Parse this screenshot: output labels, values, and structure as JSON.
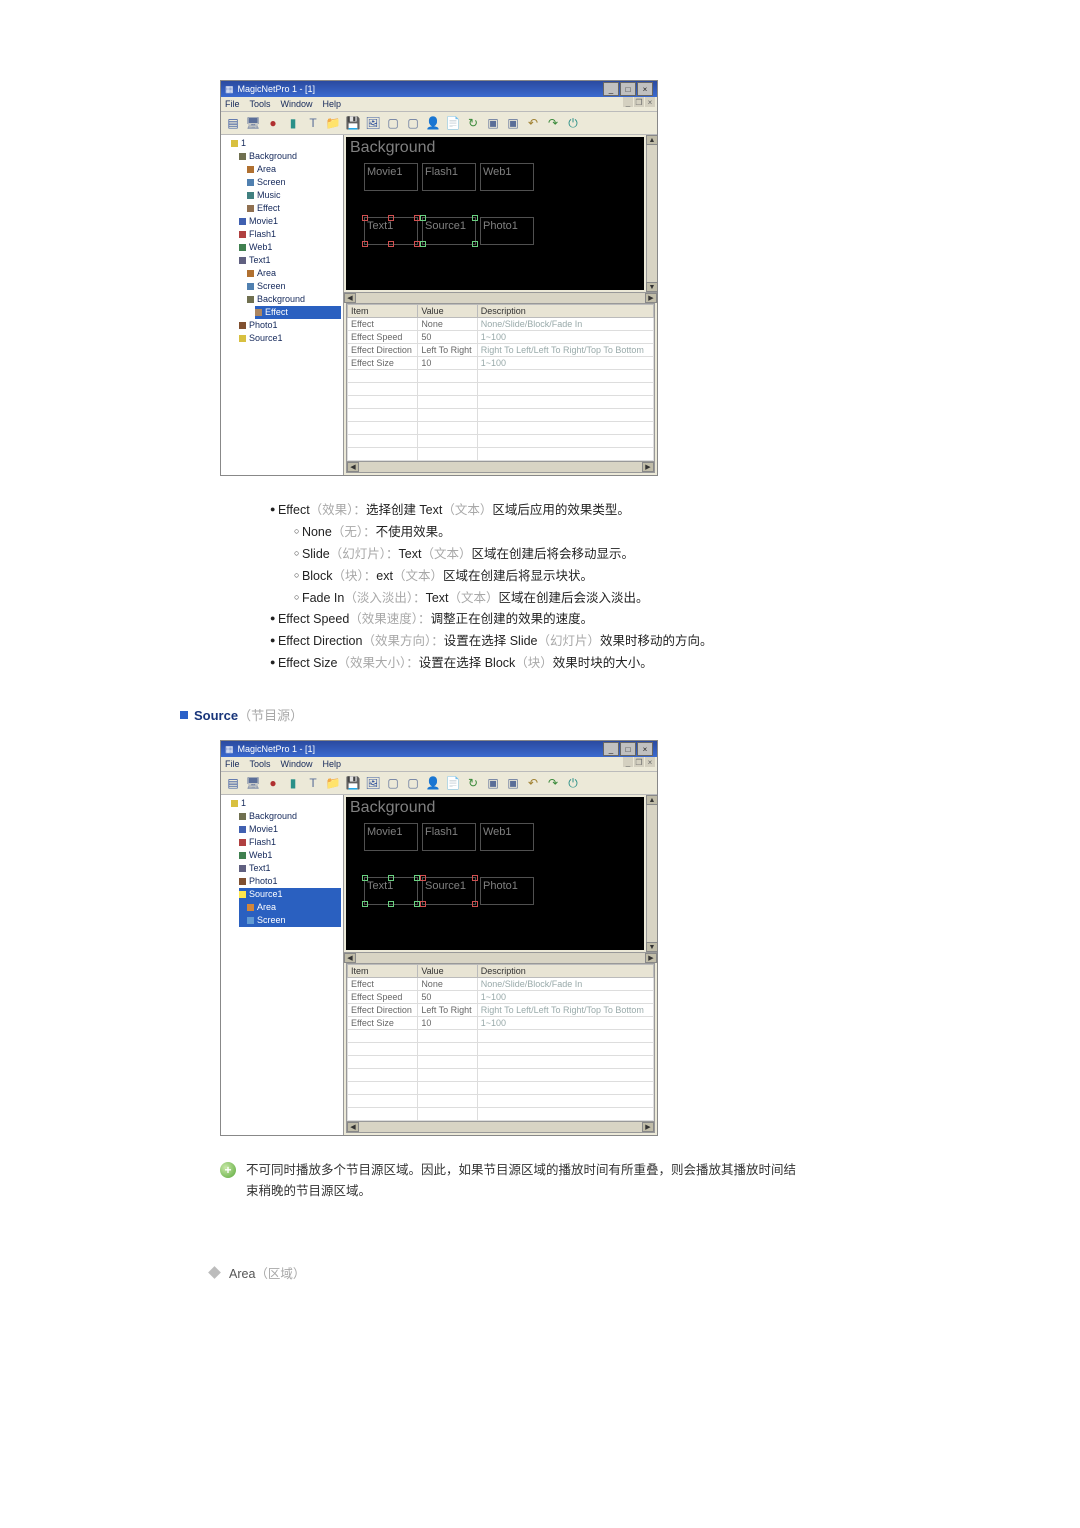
{
  "app": {
    "title": "MagicNetPro 1 - [1]",
    "menu": [
      "File",
      "Tools",
      "Window",
      "Help"
    ],
    "canvas": {
      "bg_label": "Background",
      "top_clips": [
        "Movie1",
        "Flash1",
        "Web1"
      ],
      "bottom_clips": [
        "Text1",
        "Source1",
        "Photo1"
      ]
    },
    "grid": {
      "headers": [
        "Item",
        "Value",
        "Description"
      ],
      "rows": [
        {
          "item": "Effect",
          "value": "None",
          "desc": "None/Slide/Block/Fade In"
        },
        {
          "item": "Effect Speed",
          "value": "50",
          "desc": "1~100"
        },
        {
          "item": "Effect Direction",
          "value": "Left To Right",
          "desc": "Right To Left/Left To Right/Top To Bottom"
        },
        {
          "item": "Effect Size",
          "value": "10",
          "desc": "1~100"
        }
      ]
    }
  },
  "tree1": [
    {
      "cls": "folder",
      "label": "1",
      "root": true
    },
    {
      "cls": "bg",
      "label": "Background",
      "d": 1
    },
    {
      "cls": "area",
      "label": "Area",
      "d": 2
    },
    {
      "cls": "screen",
      "label": "Screen",
      "d": 2
    },
    {
      "cls": "music",
      "label": "Music",
      "d": 2
    },
    {
      "cls": "effect",
      "label": "Effect",
      "d": 2
    },
    {
      "cls": "movie",
      "label": "Movie1",
      "d": 1
    },
    {
      "cls": "flash",
      "label": "Flash1",
      "d": 1
    },
    {
      "cls": "web",
      "label": "Web1",
      "d": 1
    },
    {
      "cls": "text",
      "label": "Text1",
      "d": 1
    },
    {
      "cls": "area",
      "label": "Area",
      "d": 2
    },
    {
      "cls": "screen",
      "label": "Screen",
      "d": 2
    },
    {
      "cls": "bg",
      "label": "Background",
      "d": 2
    },
    {
      "cls": "effect",
      "label": "Effect",
      "d": 3,
      "sel": true
    },
    {
      "cls": "photo",
      "label": "Photo1",
      "d": 1
    },
    {
      "cls": "folder",
      "label": "Source1",
      "d": 1
    }
  ],
  "tree2": [
    {
      "cls": "folder",
      "label": "1",
      "root": true
    },
    {
      "cls": "bg",
      "label": "Background",
      "d": 1
    },
    {
      "cls": "movie",
      "label": "Movie1",
      "d": 1
    },
    {
      "cls": "flash",
      "label": "Flash1",
      "d": 1
    },
    {
      "cls": "web",
      "label": "Web1",
      "d": 1
    },
    {
      "cls": "text",
      "label": "Text1",
      "d": 1
    },
    {
      "cls": "photo",
      "label": "Photo1",
      "d": 1
    },
    {
      "cls": "folder",
      "label": "Source1",
      "d": 1,
      "sel": true
    },
    {
      "cls": "area",
      "label": "Area",
      "d": 2
    },
    {
      "cls": "screen",
      "label": "Screen",
      "d": 2
    }
  ],
  "doc": {
    "effect_line": {
      "b1": "Effect",
      "g1": "（效果）：",
      "t1": "选择创建 Text",
      "g2": "（文本）",
      "t2": "区域后应用的效果类型。"
    },
    "none_line": {
      "b1": "None",
      "g1": "（无）：",
      "t1": "不使用效果。"
    },
    "slide_line": {
      "b1": "Slide",
      "g1": "（幻灯片）：",
      "t1": "Text",
      "g2": "（文本）",
      "t2": "区域在创建后将会移动显示。"
    },
    "block_line": {
      "b1": "Block",
      "g1": "（块）：",
      "t1": "ext",
      "g2": "（文本）",
      "t2": "区域在创建后将显示块状。"
    },
    "fadein_line": {
      "b1": "Fade In",
      "g1": "（淡入淡出）：",
      "t1": "Text",
      "g2": "（文本）",
      "t2": "区域在创建后会淡入淡出。"
    },
    "speed_line": {
      "b1": "Effect Speed",
      "g1": "（效果速度）：",
      "t1": "调整正在创建的效果的速度。"
    },
    "dir_line": {
      "b1": "Effect Direction",
      "g1": "（效果方向）：",
      "t1": "设置在选择 Slide",
      "g2": "（幻灯片）",
      "t2": "效果时移动的方向。"
    },
    "size_line": {
      "b1": "Effect Size",
      "g1": "（效果大小）：",
      "t1": "设置在选择 Block",
      "g2": "（块）",
      "t2": "效果时块的大小。"
    },
    "source_heading": {
      "b": "Source",
      "g": "（节目源）"
    },
    "note_text": "不可同时播放多个节目源区域。因此，如果节目源区域的播放时间有所重叠，则会播放其播放时间结束稍晚的节目源区域。",
    "area_line": {
      "b": "Area",
      "g": "（区域）"
    }
  }
}
